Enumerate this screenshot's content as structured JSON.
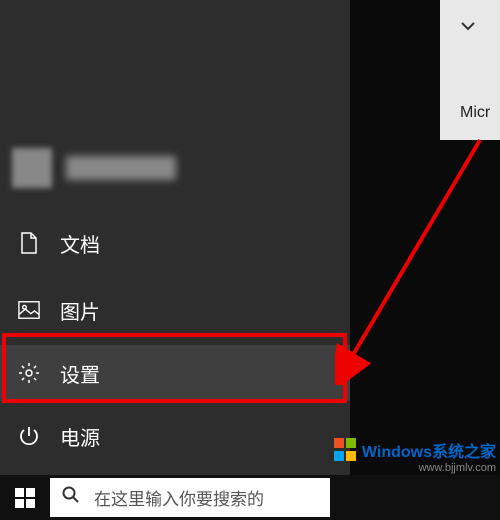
{
  "start_menu": {
    "documents": {
      "label": "文档"
    },
    "pictures": {
      "label": "图片"
    },
    "settings": {
      "label": "设置"
    },
    "power": {
      "label": "电源"
    }
  },
  "tile": {
    "partial_text": "Micr"
  },
  "taskbar": {
    "search_placeholder": "在这里输入你要搜索的"
  },
  "watermark": {
    "title": "Windows系统之家",
    "url": "www.bjjmlv.com"
  }
}
